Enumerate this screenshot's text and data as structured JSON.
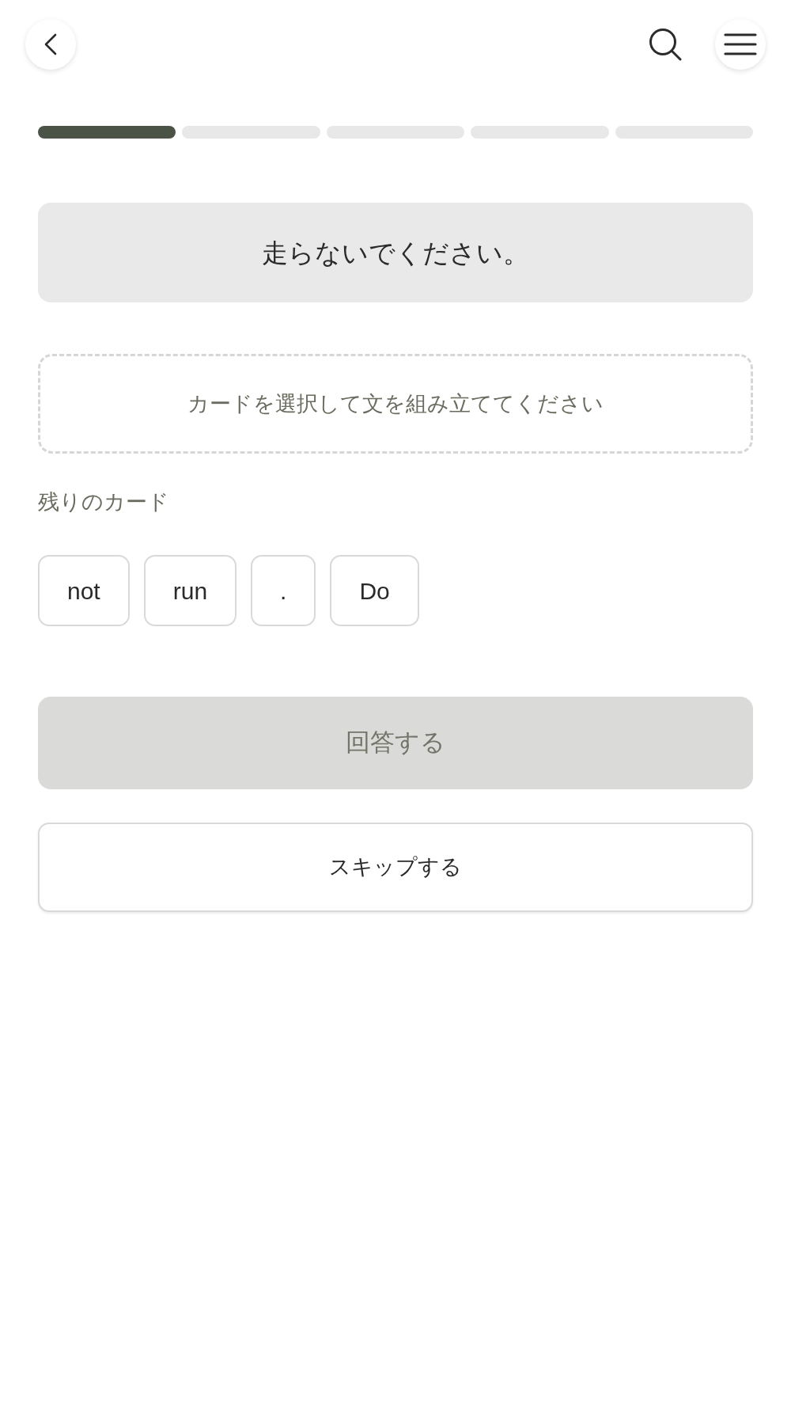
{
  "progress": {
    "steps": [
      {
        "completed": true
      },
      {
        "completed": false
      },
      {
        "completed": false
      },
      {
        "completed": false
      },
      {
        "completed": false
      }
    ]
  },
  "prompt": {
    "text": "走らないでください。"
  },
  "answer_area": {
    "placeholder": "カードを選択して文を組み立ててください"
  },
  "remaining": {
    "label": "残りのカード",
    "cards": [
      {
        "text": "not"
      },
      {
        "text": "run"
      },
      {
        "text": "."
      },
      {
        "text": "Do"
      }
    ]
  },
  "submit_button": {
    "label": "回答する",
    "disabled": true
  },
  "skip_button": {
    "label": "スキップする"
  }
}
